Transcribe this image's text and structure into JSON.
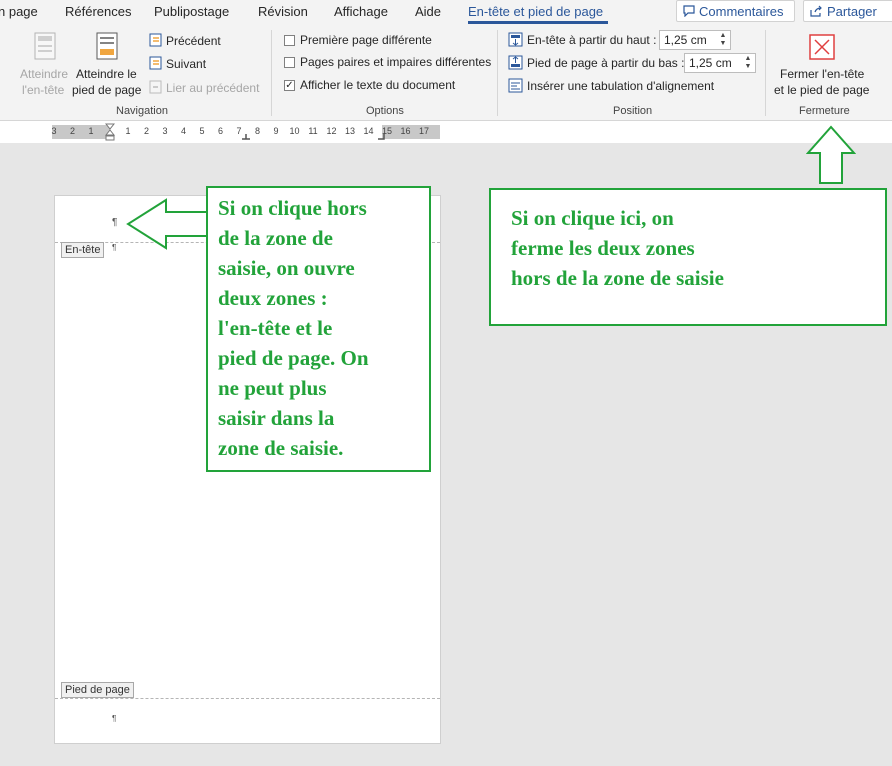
{
  "tabs": {
    "items": [
      "n page",
      "Références",
      "Publipostage",
      "Révision",
      "Affichage",
      "Aide",
      "En-tête et pied de page"
    ],
    "comments_label": "Commentaires",
    "share_label": "Partager"
  },
  "ribbon": {
    "navigation": {
      "goto_header": [
        "Atteindre",
        "l'en-tête"
      ],
      "goto_footer": [
        "Atteindre le",
        "pied de page"
      ],
      "previous": "Précédent",
      "next": "Suivant",
      "link_previous": "Lier au précédent",
      "group_label": "Navigation"
    },
    "options": {
      "different_first": "Première page différente",
      "odd_even": "Pages paires et impaires différentes",
      "show_text": "Afficher le texte du document",
      "group_label": "Options"
    },
    "position": {
      "header_from_top_label": "En-tête à partir du haut :",
      "header_from_top_value": "1,25 cm",
      "footer_from_bottom_label": "Pied de page à partir du bas :",
      "footer_from_bottom_value": "1,25 cm",
      "insert_tab": "Insérer une tabulation d'alignement",
      "group_label": "Position"
    },
    "close": {
      "label": [
        "Fermer l'en-tête",
        "et le pied de page"
      ],
      "group_label": "Fermeture"
    }
  },
  "ruler": {
    "numbers": [
      "3",
      "2",
      "1",
      "",
      "1",
      "2",
      "3",
      "4",
      "5",
      "6",
      "7",
      "8",
      "9",
      "10",
      "11",
      "12",
      "13",
      "14",
      "15",
      "16",
      "17"
    ]
  },
  "page": {
    "header_label": "En-tête",
    "footer_label": "Pied de page",
    "pilcrow": "¶"
  },
  "annotations": {
    "left_note": "Si on clique hors\nde la zone de\nsaisie, on ouvre\ndeux zones :\nl'en-tête et le\npied de page. On\nne peut plus\nsaisir dans la\nzone de saisie.",
    "right_note": "Si on clique ici, on\nferme les deux zones\nhors de la zone de saisie",
    "color": "#22a33a"
  },
  "colors": {
    "accent": "#2b579a",
    "annotation": "#22a33a",
    "close_icon": "#e04040"
  }
}
